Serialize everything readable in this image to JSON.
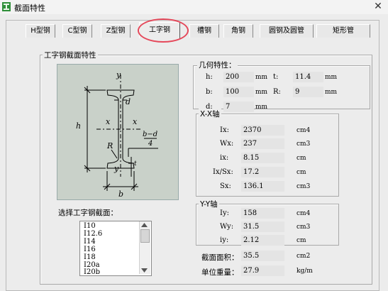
{
  "window": {
    "title": "截面特性",
    "close_glyph": "✕"
  },
  "tabs": [
    "H型钢",
    "C型钢",
    "Z型钢",
    "工字钢",
    "槽钢",
    "角钢",
    "圆钢及圆管",
    "矩形管"
  ],
  "active_tab": "工字钢",
  "section_group": {
    "title": "工字钢截面特性"
  },
  "diagram": {
    "labels": {
      "y_top": "y",
      "d": "d",
      "h": "h",
      "x_left": "x",
      "x_right": "x",
      "bd": "b−d",
      "four": "4",
      "R": "R",
      "t": "t",
      "y_bottom": "y",
      "b": "b"
    },
    "colors": {
      "bg": "#c9d1c9",
      "line": "#000000"
    }
  },
  "geometry": {
    "title": "几何特性：",
    "h": {
      "label": "h:",
      "value": "200",
      "unit": "mm"
    },
    "t": {
      "label": "t:",
      "value": "11.4",
      "unit": "mm"
    },
    "b": {
      "label": "b:",
      "value": "100",
      "unit": "mm"
    },
    "R": {
      "label": "R:",
      "value": "9",
      "unit": "mm"
    },
    "d": {
      "label": "d:",
      "value": "7",
      "unit": "mm"
    }
  },
  "xx_axis": {
    "title": "X-X轴",
    "Ix": {
      "label": "Ix:",
      "value": "2370",
      "unit": "cm4"
    },
    "Wx": {
      "label": "Wx:",
      "value": "237",
      "unit": "cm3"
    },
    "ix": {
      "label": "ix:",
      "value": "8.15",
      "unit": "cm"
    },
    "IxSx": {
      "label": "Ix/Sx:",
      "value": "17.2",
      "unit": "cm"
    },
    "Sx": {
      "label": "Sx:",
      "value": "136.1",
      "unit": "cm3"
    }
  },
  "yy_axis": {
    "title": "Y-Y轴",
    "Iy": {
      "label": "Iy:",
      "value": "158",
      "unit": "cm4"
    },
    "Wy": {
      "label": "Wy:",
      "value": "31.5",
      "unit": "cm3"
    },
    "iy": {
      "label": "iy:",
      "value": "2.12",
      "unit": "cm"
    }
  },
  "area": {
    "label": "截面面积：",
    "value": "35.5",
    "unit": "cm2"
  },
  "weight": {
    "label": "单位重量：",
    "value": "27.9",
    "unit": "kg/m"
  },
  "select_label": "选择工字钢截面：",
  "sections": [
    "I10",
    "I12.6",
    "I14",
    "I16",
    "I18",
    "I20a",
    "I20b"
  ]
}
